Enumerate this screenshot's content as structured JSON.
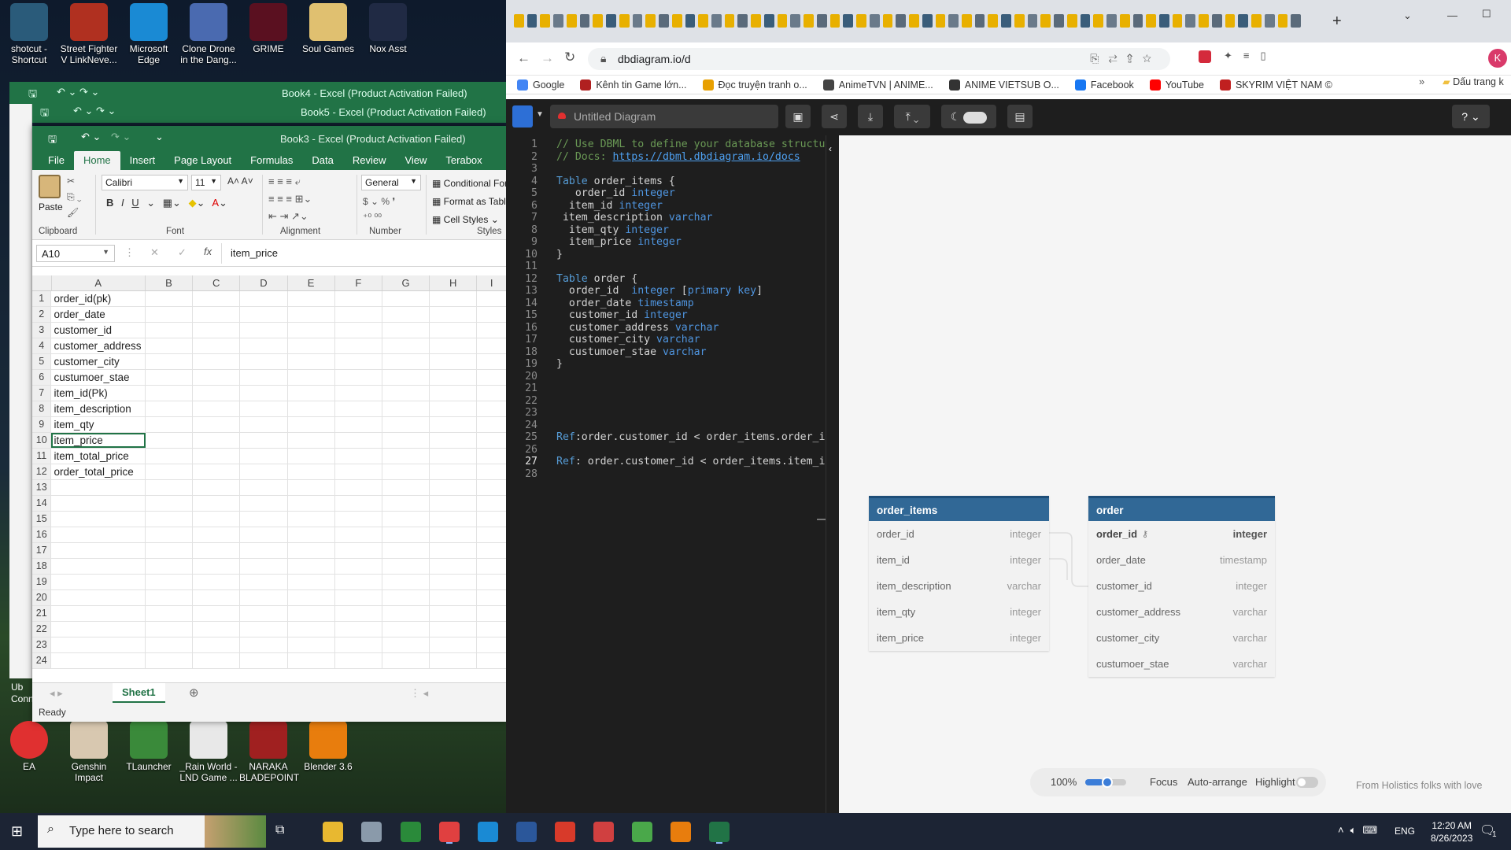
{
  "desktop": {
    "top_icons": [
      {
        "label": "shotcut - Shortcut",
        "color": "#2a5b7a"
      },
      {
        "label": "Street Fighter V LinkNeve...",
        "color": "#b03020"
      },
      {
        "label": "Microsoft Edge",
        "color": "#1a8ad4"
      },
      {
        "label": "Clone Drone in the Dang...",
        "color": "#4a6ab0"
      },
      {
        "label": "GRIME",
        "color": "#5a1020"
      },
      {
        "label": "Soul Games",
        "color": "#e0c070"
      },
      {
        "label": "Nox Asst",
        "color": "#202a44"
      }
    ],
    "bottom_icons": [
      {
        "label": "EA",
        "color": "#e03030"
      },
      {
        "label": "Genshin Impact",
        "color": "#d8c8b0"
      },
      {
        "label": "TLauncher",
        "color": "#3a8a3a"
      },
      {
        "label": "_Rain World - LND Game ...",
        "color": "#e8e8e8"
      },
      {
        "label": "NARAKA BLADEPOINT",
        "color": "#a02020"
      },
      {
        "label": "Blender 3.6",
        "color": "#e87d0d"
      }
    ],
    "left_fragments": [
      "Ub",
      "Conn"
    ]
  },
  "excel": {
    "back_windows": [
      "Book4 - Excel (Product Activation Failed)",
      "Book5 - Excel (Product Activation Failed)"
    ],
    "title": "Book3 - Excel (Product Activation Failed)",
    "tabs": [
      "File",
      "Home",
      "Insert",
      "Page Layout",
      "Formulas",
      "Data",
      "Review",
      "View",
      "Terabox"
    ],
    "active_tab": "Home",
    "ribbon": {
      "paste": "Paste",
      "clipboard": "Clipboard",
      "font_name": "Calibri",
      "font_size": "11",
      "font": "Font",
      "alignment": "Alignment",
      "number_format": "General",
      "number": "Number",
      "conditional": "Conditional For",
      "format_table": "Format as Table",
      "cell_styles": "Cell Styles",
      "styles": "Styles"
    },
    "name_box": "A10",
    "formula": "item_price",
    "columns": [
      "A",
      "B",
      "C",
      "D",
      "E",
      "F",
      "G",
      "H",
      "I"
    ],
    "rows": [
      {
        "n": "1",
        "a": "order_id(pk)"
      },
      {
        "n": "2",
        "a": "order_date"
      },
      {
        "n": "3",
        "a": "customer_id"
      },
      {
        "n": "4",
        "a": "customer_address"
      },
      {
        "n": "5",
        "a": "customer_city"
      },
      {
        "n": "6",
        "a": "custumoer_stae"
      },
      {
        "n": "7",
        "a": "item_id(Pk)"
      },
      {
        "n": "8",
        "a": "item_description"
      },
      {
        "n": "9",
        "a": "item_qty"
      },
      {
        "n": "10",
        "a": "item_price"
      },
      {
        "n": "11",
        "a": "item_total_price"
      },
      {
        "n": "12",
        "a": "order_total_price"
      },
      {
        "n": "13",
        "a": ""
      },
      {
        "n": "14",
        "a": ""
      },
      {
        "n": "15",
        "a": ""
      },
      {
        "n": "16",
        "a": ""
      },
      {
        "n": "17",
        "a": ""
      },
      {
        "n": "18",
        "a": ""
      },
      {
        "n": "19",
        "a": ""
      },
      {
        "n": "20",
        "a": ""
      },
      {
        "n": "21",
        "a": ""
      },
      {
        "n": "22",
        "a": ""
      },
      {
        "n": "23",
        "a": ""
      },
      {
        "n": "24",
        "a": ""
      }
    ],
    "sheet": "Sheet1",
    "status": "Ready"
  },
  "browser": {
    "url": "dbdiagram.io/d",
    "bookmarks": [
      {
        "label": "Google",
        "color": "#4285f4"
      },
      {
        "label": "Kênh tin Game lớn...",
        "color": "#b02020"
      },
      {
        "label": "Đọc truyện tranh o...",
        "color": "#e8a000"
      },
      {
        "label": "AnimeTVN | ANIME...",
        "color": "#444444"
      },
      {
        "label": "ANIME VIETSUB O...",
        "color": "#333333"
      },
      {
        "label": "Facebook",
        "color": "#1877f2"
      },
      {
        "label": "YouTube",
        "color": "#ff0000"
      },
      {
        "label": "SKYRIM VIỆT NAM ©",
        "color": "#c02020"
      }
    ],
    "bookmark_folder": "Dấu trang k",
    "profile_initial": "K"
  },
  "dbdiagram": {
    "doc_title": "Untitled Diagram",
    "help": "?",
    "code_lines": [
      {
        "n": "1",
        "t": "// Use DBML to define your database structure"
      },
      {
        "n": "2",
        "t": "// Docs: https://dbml.dbdiagram.io/docs"
      },
      {
        "n": "3",
        "t": ""
      },
      {
        "n": "4",
        "t": "Table order_items {"
      },
      {
        "n": "5",
        "t": "   order_id integer"
      },
      {
        "n": "6",
        "t": "  item_id integer"
      },
      {
        "n": "7",
        "t": " item_description varchar"
      },
      {
        "n": "8",
        "t": "  item_qty integer"
      },
      {
        "n": "9",
        "t": "  item_price integer"
      },
      {
        "n": "10",
        "t": "}"
      },
      {
        "n": "11",
        "t": ""
      },
      {
        "n": "12",
        "t": "Table order {"
      },
      {
        "n": "13",
        "t": "  order_id  integer [primary key]"
      },
      {
        "n": "14",
        "t": "  order_date timestamp"
      },
      {
        "n": "15",
        "t": "  customer_id integer"
      },
      {
        "n": "16",
        "t": "  customer_address varchar"
      },
      {
        "n": "17",
        "t": "  customer_city varchar"
      },
      {
        "n": "18",
        "t": "  custumoer_stae varchar"
      },
      {
        "n": "19",
        "t": "}"
      },
      {
        "n": "20",
        "t": ""
      },
      {
        "n": "21",
        "t": ""
      },
      {
        "n": "22",
        "t": ""
      },
      {
        "n": "23",
        "t": ""
      },
      {
        "n": "24",
        "t": ""
      },
      {
        "n": "25",
        "t": "Ref:order.customer_id < order_items.order_id"
      },
      {
        "n": "26",
        "t": ""
      },
      {
        "n": "27",
        "t": "Ref: order.customer_id < order_items.item_id"
      },
      {
        "n": "28",
        "t": ""
      }
    ],
    "current_line": "27",
    "tables": [
      {
        "name": "order_items",
        "fields": [
          {
            "name": "order_id",
            "type": "integer"
          },
          {
            "name": "item_id",
            "type": "integer"
          },
          {
            "name": "item_description",
            "type": "varchar"
          },
          {
            "name": "item_qty",
            "type": "integer"
          },
          {
            "name": "item_price",
            "type": "integer"
          }
        ]
      },
      {
        "name": "order",
        "fields": [
          {
            "name": "order_id",
            "type": "integer",
            "pk": true
          },
          {
            "name": "order_date",
            "type": "timestamp"
          },
          {
            "name": "customer_id",
            "type": "integer"
          },
          {
            "name": "customer_address",
            "type": "varchar"
          },
          {
            "name": "customer_city",
            "type": "varchar"
          },
          {
            "name": "custumoer_stae",
            "type": "varchar"
          }
        ]
      }
    ],
    "zoom": "100%",
    "zoom_level": 0.45,
    "focus": "Focus",
    "auto_arrange": "Auto-arrange",
    "highlight": "Highlight",
    "footer": "From Holistics folks with love"
  },
  "taskbar": {
    "search_placeholder": "Type here to search",
    "lang": "ENG",
    "time": "12:20 AM",
    "date": "8/26/2023",
    "notifications": "1"
  }
}
